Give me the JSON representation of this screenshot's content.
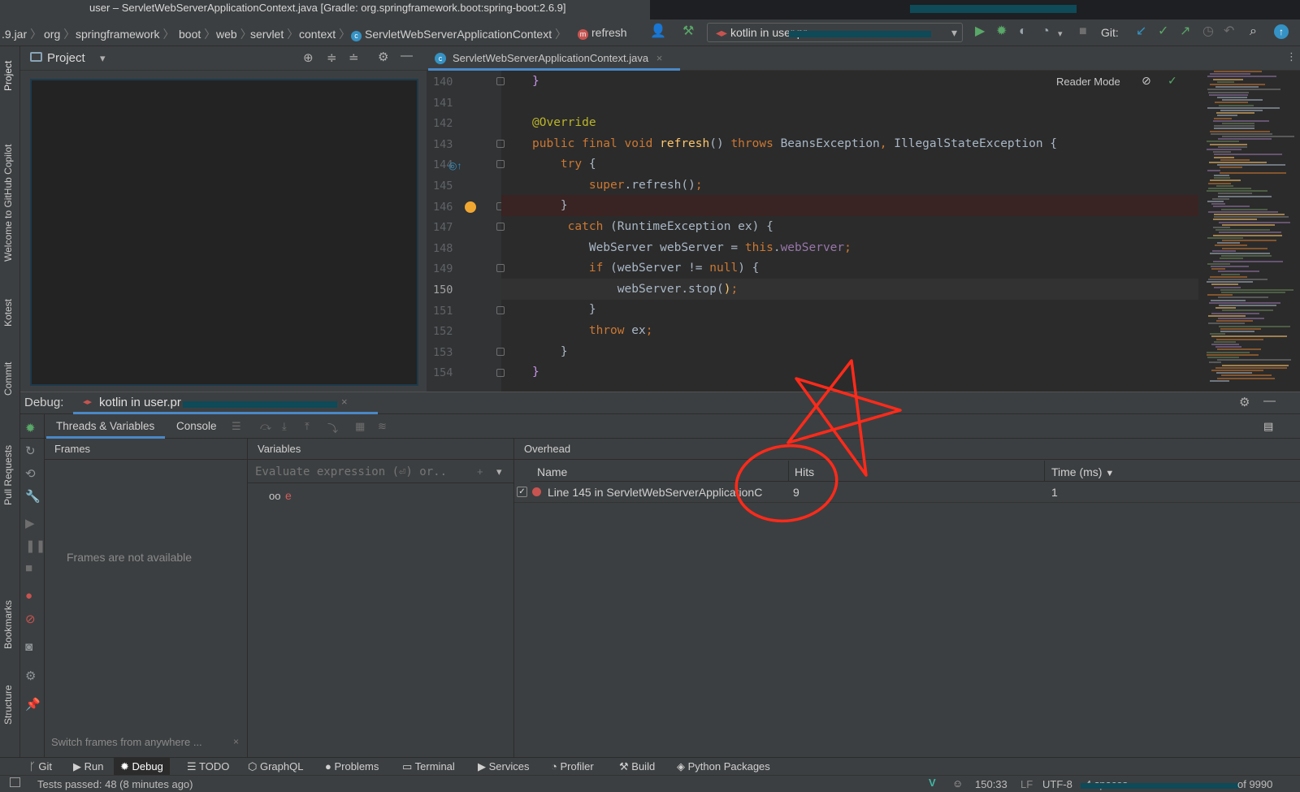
{
  "window": {
    "title": "user – ServletWebServerApplicationContext.java [Gradle: org.springframework.boot:spring-boot:2.6.9]"
  },
  "breadcrumbs": [
    ".9.jar",
    "org",
    "springframework",
    "boot",
    "web",
    "servlet",
    "context",
    "ServletWebServerApplicationContext",
    "refresh"
  ],
  "toolbar": {
    "run_config": "kotlin in user.pr",
    "git_label": "Git:"
  },
  "left_strip": [
    "Project",
    "Welcome to GitHub Copilot",
    "Kotest",
    "Commit",
    "Pull Requests",
    "Bookmarks",
    "Structure"
  ],
  "project_panel": {
    "title": "Project"
  },
  "editor": {
    "tab_label": "ServletWebServerApplicationContext.java",
    "reader_mode": "Reader Mode",
    "line_numbers": [
      "140",
      "141",
      "142",
      "143",
      "144",
      "145",
      "146",
      "147",
      "148",
      "149",
      "150",
      "151",
      "152",
      "153",
      "154"
    ],
    "current_line": "150",
    "breakpoint_line": "145"
  },
  "debug": {
    "label": "Debug:",
    "session": "kotlin in user.pr",
    "tabs": [
      "Threads & Variables",
      "Console"
    ],
    "frames_header": "Frames",
    "frames_empty": "Frames are not available",
    "frames_hint": "Switch frames from anywhere ...",
    "variables_header": "Variables",
    "evaluate_placeholder": "Evaluate expression (⏎) or..",
    "watch_var": "e",
    "overhead_header": "Overhead",
    "table": {
      "columns": [
        "Name",
        "Hits",
        "Time (ms)"
      ],
      "rows": [
        {
          "name": "Line 145 in ServletWebServerApplicationC",
          "hits": "9",
          "time": "1"
        }
      ]
    }
  },
  "bottom_tools": [
    "Git",
    "Run",
    "Debug",
    "TODO",
    "GraphQL",
    "Problems",
    "Terminal",
    "Services",
    "Profiler",
    "Build",
    "Python Packages"
  ],
  "status": {
    "tests": "Tests passed: 48 (8 minutes ago)",
    "position": "150:33",
    "line_sep": "LF",
    "encoding": "UTF-8",
    "indent": "4 spaces",
    "tail": "of 9990"
  },
  "colors": {
    "accent": "#4a88c7",
    "breakpoint": "#c75450",
    "annotation": "#ff2a1a"
  }
}
